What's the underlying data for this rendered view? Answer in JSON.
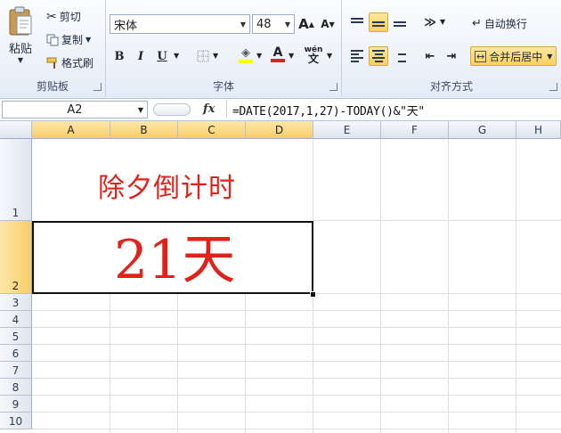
{
  "clipboard": {
    "paste_label": "粘贴",
    "cut_label": "剪切",
    "copy_label": "复制",
    "format_painter_label": "格式刷",
    "group_label": "剪贴板"
  },
  "font": {
    "name": "宋体",
    "size": "48",
    "bold": "B",
    "italic": "I",
    "underline": "U",
    "grow": "A",
    "shrink": "A",
    "font_color_letter": "A",
    "phonetic": "wén",
    "group_label": "字体"
  },
  "alignment": {
    "wrap_text_label": "自动换行",
    "merge_center_label": "合并后居中",
    "group_label": "对齐方式"
  },
  "formula_bar": {
    "name_box": "A2",
    "fx": "fx",
    "formula": "=DATE(2017,1,27)-TODAY()&\"天\""
  },
  "columns": [
    "A",
    "B",
    "C",
    "D",
    "E",
    "F",
    "G",
    "H"
  ],
  "rows": [
    "1",
    "2",
    "3",
    "4",
    "5",
    "6",
    "7",
    "8",
    "9",
    "10"
  ],
  "cells": {
    "row1_text": "除夕倒计时",
    "row2_text": "21天"
  },
  "colors": {
    "cell_text": "#e0221b",
    "selection_header": "#f8cd68"
  }
}
